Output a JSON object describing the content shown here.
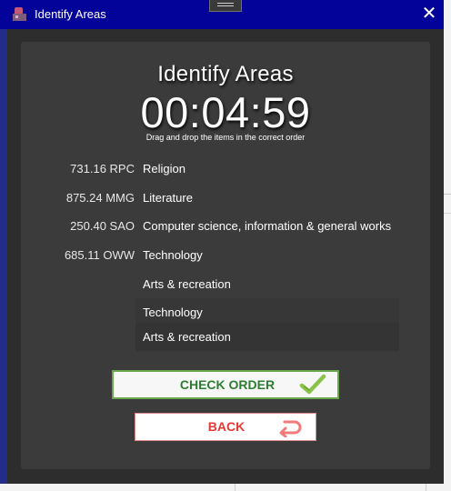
{
  "window": {
    "title": "Identify Areas",
    "close_glyph": "✕"
  },
  "card": {
    "heading": "Identify Areas",
    "timer": "00:04:59",
    "instruction": "Drag and drop the items in the correct order"
  },
  "codes": [
    "731.16 RPC",
    "875.24 MMG",
    "250.40 SAO",
    "685.11 OWW"
  ],
  "slots": [
    "Religion",
    "Literature",
    "Computer science, information & general works",
    "Technology",
    "Arts & recreation",
    "Technology",
    "Arts & recreation"
  ],
  "buttons": {
    "check": "CHECK ORDER",
    "back": "BACK"
  },
  "colors": {
    "titlebar": "#03039a",
    "card": "#3b3b3b",
    "check_text": "#2e7d32",
    "check_icon": "#8bc34a",
    "back_text": "#e53935",
    "back_icon": "#ef7b7b"
  },
  "icons": {
    "app": "app-icon",
    "check": "checkmark-icon",
    "back": "return-arrow-icon"
  }
}
